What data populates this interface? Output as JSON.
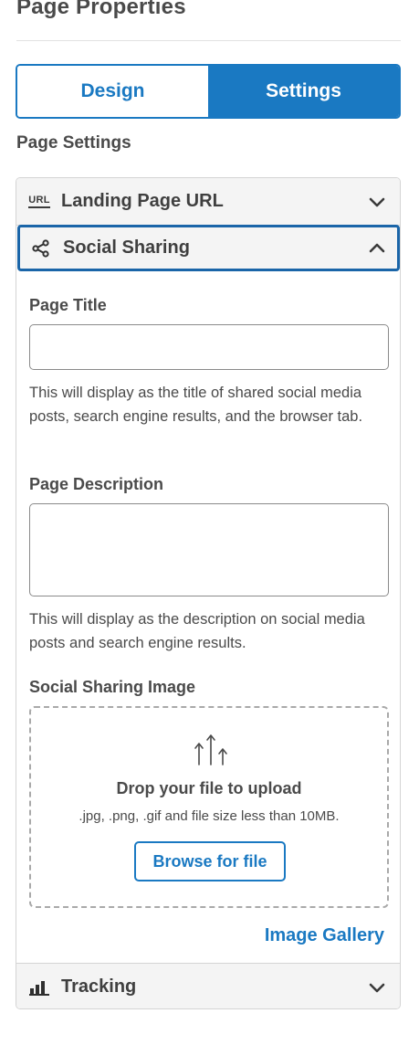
{
  "panel": {
    "title": "Page Properties"
  },
  "tabs": [
    {
      "label": "Design",
      "active": false
    },
    {
      "label": "Settings",
      "active": true
    }
  ],
  "page_settings": {
    "heading": "Page Settings",
    "sections": {
      "landing_url": {
        "label": "Landing Page URL",
        "icon": "url-icon",
        "icon_text": "URL",
        "expanded": false
      },
      "social_sharing": {
        "label": "Social Sharing",
        "icon": "share-icon",
        "expanded": true
      },
      "tracking": {
        "label": "Tracking",
        "icon": "bar-chart-icon",
        "expanded": false
      }
    }
  },
  "social": {
    "page_title": {
      "label": "Page Title",
      "value": "",
      "help": "This will display as the title of shared social media posts, search engine results, and the browser tab."
    },
    "page_description": {
      "label": "Page Description",
      "value": "",
      "help": "This will display as the description on social media posts and search engine results."
    },
    "image": {
      "label": "Social Sharing Image",
      "drop_title": "Drop your file to upload",
      "drop_hint": ".jpg, .png, .gif and file size less than 10MB.",
      "browse_label": "Browse for file",
      "gallery_label": "Image Gallery"
    }
  },
  "colors": {
    "accent": "#1a79c2",
    "focus_border": "#1a65a8",
    "header_bg": "#f4f4f4"
  }
}
